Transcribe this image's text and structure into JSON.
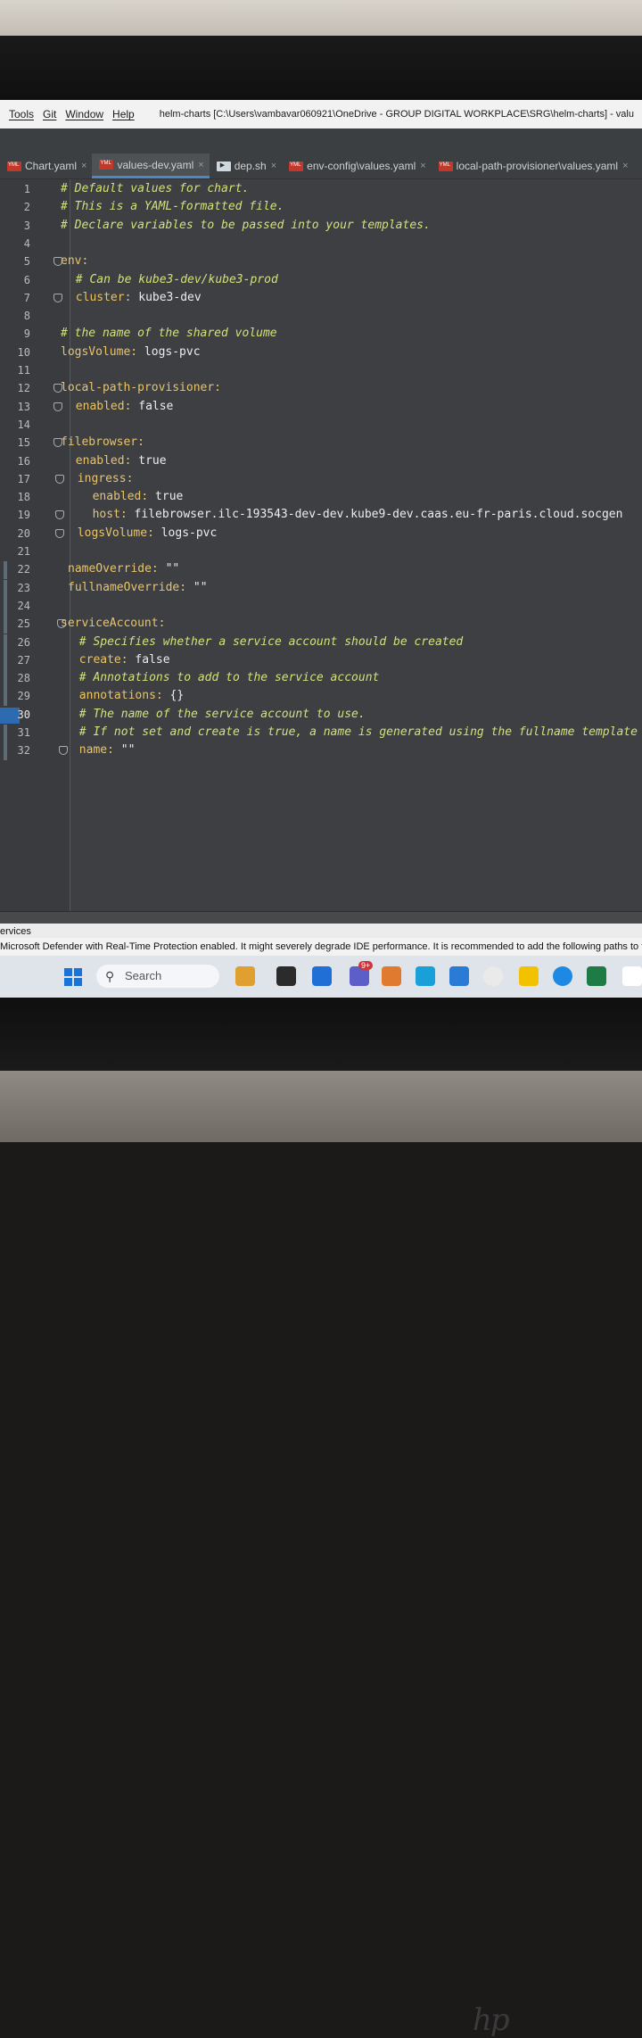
{
  "menu": {
    "items": [
      "Tools",
      "Git",
      "Window",
      "Help"
    ],
    "window_title": "helm-charts [C:\\Users\\vambavar060921\\OneDrive - GROUP DIGITAL WORKPLACE\\SRG\\helm-charts] - valu"
  },
  "tabs": [
    {
      "label": "Chart.yaml",
      "icon": "yaml-file-icon",
      "active": false
    },
    {
      "label": "values-dev.yaml",
      "icon": "yaml-file-icon",
      "active": true
    },
    {
      "label": "dep.sh",
      "icon": "shell-script-icon",
      "active": false
    },
    {
      "label": "env-config\\values.yaml",
      "icon": "yaml-file-icon",
      "active": false
    },
    {
      "label": "local-path-provisioner\\values.yaml",
      "icon": "yaml-file-icon",
      "active": false
    }
  ],
  "editor": {
    "lines": [
      {
        "n": "1",
        "text": "# Default values for chart.",
        "kind": "comment",
        "indent": 0
      },
      {
        "n": "2",
        "text": "# This is a YAML-formatted file.",
        "kind": "comment",
        "indent": 0
      },
      {
        "n": "3",
        "text": "# Declare variables to be passed into your templates.",
        "kind": "comment",
        "indent": 0
      },
      {
        "n": "4",
        "text": "",
        "kind": "blank",
        "indent": 0
      },
      {
        "n": "5",
        "key": "env:",
        "kind": "key",
        "indent": 0
      },
      {
        "n": "6",
        "text": "# Can be kube3-dev/kube3-prod",
        "kind": "comment",
        "indent": 2
      },
      {
        "n": "7",
        "key": "cluster:",
        "value": " kube3-dev",
        "kind": "pair",
        "indent": 2
      },
      {
        "n": "8",
        "text": "",
        "kind": "blank",
        "indent": 0
      },
      {
        "n": "9",
        "text": "# the name of the shared volume",
        "kind": "comment",
        "indent": 0
      },
      {
        "n": "10",
        "key": "logsVolume:",
        "value": " logs-pvc",
        "kind": "pair",
        "indent": 0
      },
      {
        "n": "11",
        "text": "",
        "kind": "blank",
        "indent": 0
      },
      {
        "n": "12",
        "key": "local-path-provisioner:",
        "kind": "key",
        "indent": 0
      },
      {
        "n": "13",
        "key": "enabled:",
        "value": " false",
        "kind": "pair",
        "indent": 2
      },
      {
        "n": "14",
        "text": "",
        "kind": "blank",
        "indent": 0
      },
      {
        "n": "15",
        "key": "filebrowser:",
        "kind": "key",
        "indent": 0
      },
      {
        "n": "16",
        "key": "enabled:",
        "value": " true",
        "kind": "pair",
        "indent": 2
      },
      {
        "n": "17",
        "key": "ingress:",
        "kind": "key",
        "indent": 2
      },
      {
        "n": "18",
        "key": "enabled:",
        "value": " true",
        "kind": "pair",
        "indent": 4
      },
      {
        "n": "19",
        "key": "host:",
        "value": " filebrowser.ilc-193543-dev-dev.kube9-dev.caas.eu-fr-paris.cloud.socgen",
        "kind": "pair",
        "indent": 4
      },
      {
        "n": "20",
        "key": "logsVolume:",
        "value": " logs-pvc",
        "kind": "pair",
        "indent": 2
      },
      {
        "n": "21",
        "text": "",
        "kind": "blank",
        "indent": 0
      },
      {
        "n": "22",
        "key": "nameOverride:",
        "value": " \"\"",
        "kind": "pair",
        "indent": 0
      },
      {
        "n": "23",
        "key": "fullnameOverride:",
        "value": " \"\"",
        "kind": "pair",
        "indent": 0
      },
      {
        "n": "24",
        "text": "",
        "kind": "blank",
        "indent": 0
      },
      {
        "n": "25",
        "key": "serviceAccount:",
        "kind": "key",
        "indent": 0
      },
      {
        "n": "26",
        "text": "# Specifies whether a service account should be created",
        "kind": "comment",
        "indent": 2
      },
      {
        "n": "27",
        "key": "create:",
        "value": " false",
        "kind": "pair",
        "indent": 2
      },
      {
        "n": "28",
        "text": "# Annotations to add to the service account",
        "kind": "comment",
        "indent": 2
      },
      {
        "n": "29",
        "key": "annotations:",
        "value": " {}",
        "kind": "pair",
        "indent": 2
      },
      {
        "n": "30",
        "text": "# The name of the service account to use.",
        "kind": "comment",
        "indent": 2
      },
      {
        "n": "31",
        "text": "# If not set and create is true, a name is generated using the fullname template",
        "kind": "comment",
        "indent": 2
      },
      {
        "n": "32",
        "key": "name:",
        "value": " \"\"",
        "kind": "pair",
        "indent": 2
      }
    ]
  },
  "status": {
    "services_label": "ervices",
    "notification": "Microsoft Defender with Real-Time Protection enabled. It might severely degrade IDE performance. It is recommended to add the following paths to the Def"
  },
  "taskbar": {
    "search_label": "Search",
    "brand_logo": "hp",
    "icons": [
      "windows-start-icon",
      "search-icon",
      "briefcase-icon",
      "file-explorer-icon",
      "outlook-icon",
      "teams-icon",
      "paint-icon",
      "edge-icon",
      "store-icon",
      "chrome-icon",
      "sticky-notes-icon",
      "chrome-alt-icon",
      "excel-icon",
      "snipping-tool-icon"
    ],
    "teams_badge": "9+"
  },
  "colors": {
    "editor_bg": "#3d3f42",
    "comment": "#d4e07a",
    "key": "#e8c46a",
    "value": "#ecedee",
    "active_tab_underline": "#4a88c7"
  }
}
